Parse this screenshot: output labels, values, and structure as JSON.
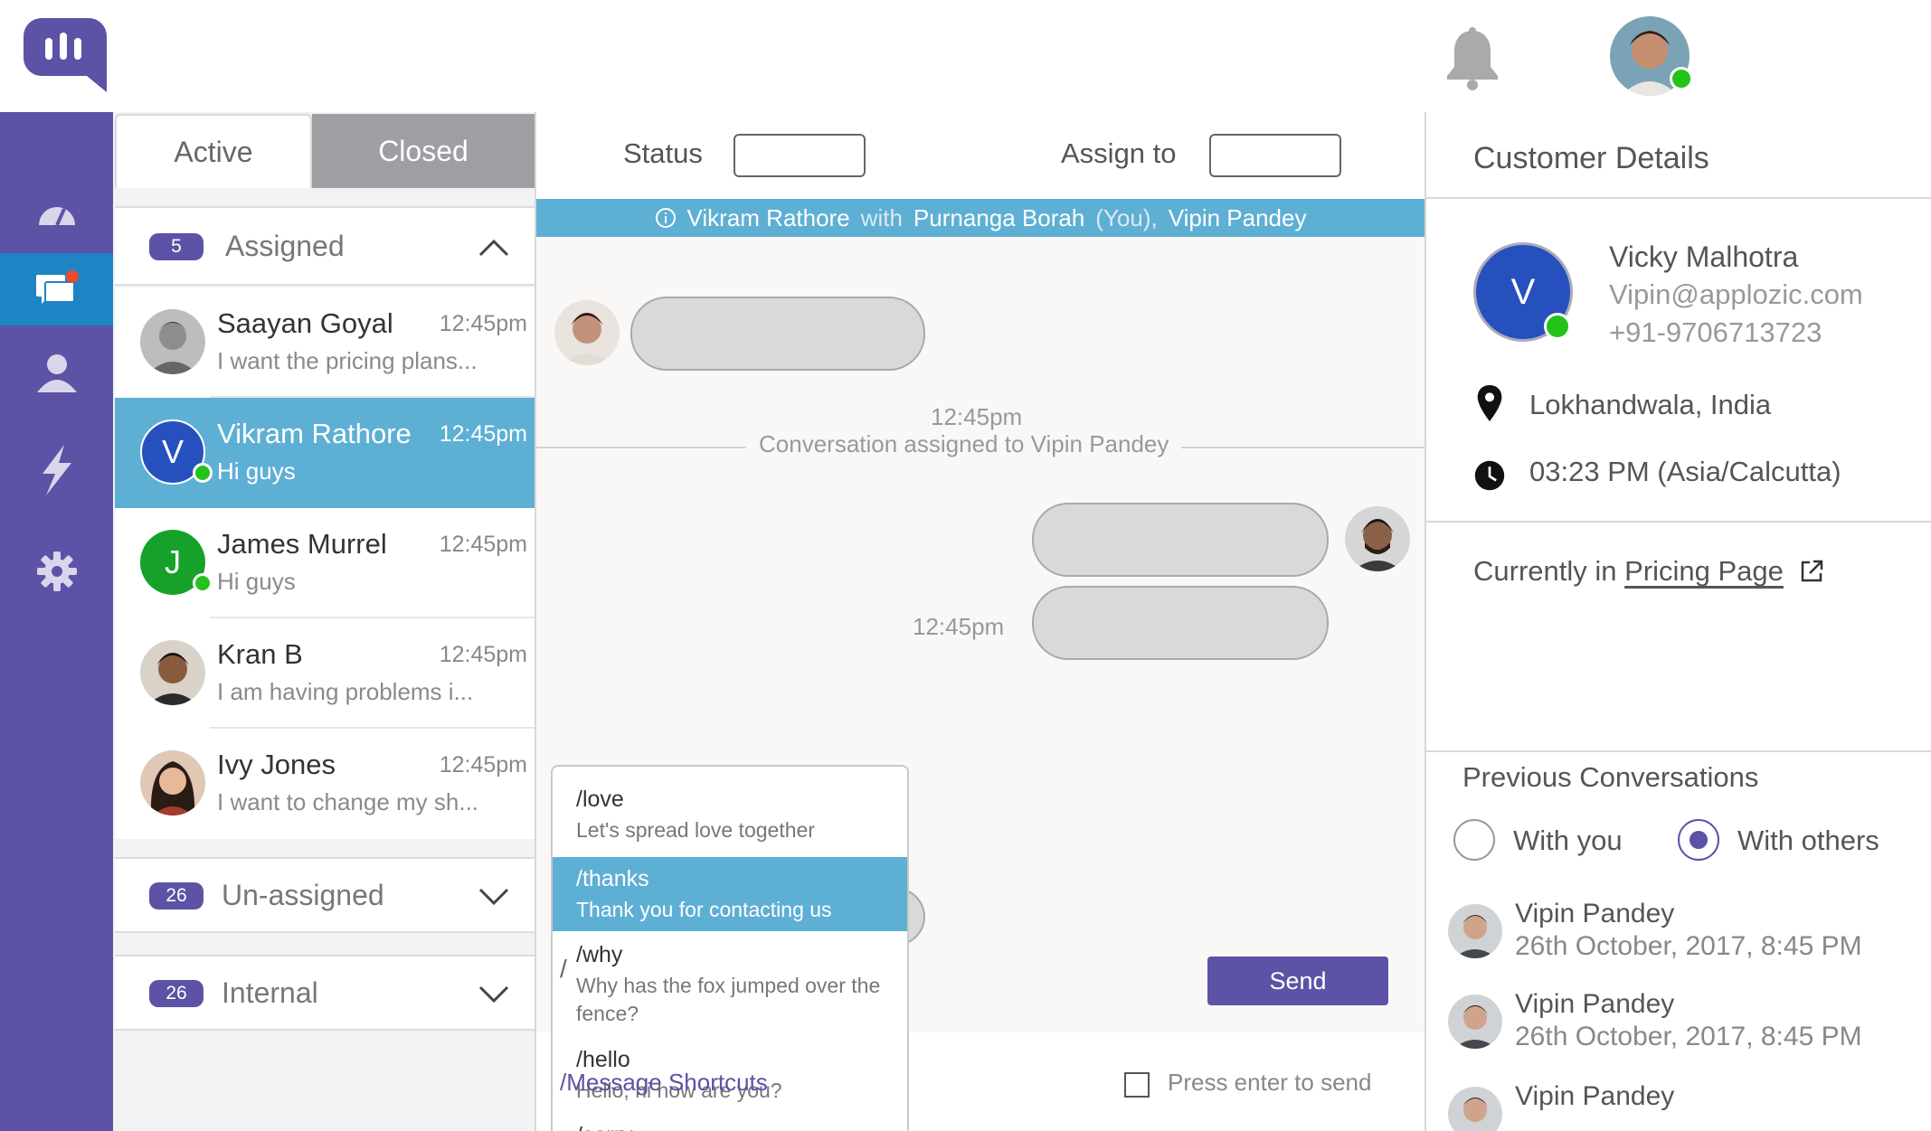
{
  "colors": {
    "brand": "#5c52a6",
    "accent_blue": "#5eafd4",
    "nav_active": "#1f84c4",
    "online": "#22c41a"
  },
  "header": {
    "logo_icon": "chat-logo-icon",
    "bell_icon": "bell-icon"
  },
  "nav": {
    "items": [
      "dashboard-icon",
      "conversations-icon",
      "users-icon",
      "integrations-icon",
      "settings-icon"
    ]
  },
  "tabs": {
    "active": "Active",
    "closed": "Closed"
  },
  "sections": {
    "assigned": {
      "count": "5",
      "label": "Assigned"
    },
    "unassigned": {
      "count": "26",
      "label": "Un-assigned"
    },
    "internal": {
      "count": "26",
      "label": "Internal"
    }
  },
  "conversations": [
    {
      "name": "Saayan Goyal",
      "time": "12:45pm",
      "msg": "I want the pricing plans..."
    },
    {
      "name": "Vikram Rathore",
      "time": "12:45pm",
      "msg": "Hi guys",
      "initial": "V"
    },
    {
      "name": "James Murrel",
      "time": "12:45pm",
      "msg": "Hi guys",
      "initial": "J"
    },
    {
      "name": "Kran B",
      "time": "12:45pm",
      "msg": "I am having problems i..."
    },
    {
      "name": "Ivy Jones",
      "time": "12:45pm",
      "msg": "I want to change my sh..."
    }
  ],
  "chat": {
    "status_label": "Status",
    "assign_label": "Assign to",
    "info": {
      "customer": "Vikram Rathore",
      "with": "with",
      "agent": "Purnanga Borah",
      "you": "(You),",
      "other": "Vipin Pandey"
    },
    "time1": "12:45pm",
    "assigned_note": "Conversation assigned to Vipin Pandey",
    "time2": "12:45pm",
    "compose_value": "/",
    "send": "Send",
    "shortcut_link": "/Message Shortcuts",
    "enter_label": "Press enter to send"
  },
  "shortcuts": [
    {
      "key": "/love",
      "desc": "Let's spread love together"
    },
    {
      "key": "/thanks",
      "desc": "Thank you for contacting us"
    },
    {
      "key": "/why",
      "desc": "Why has the fox jumped over the fence?"
    },
    {
      "key": "/hello",
      "desc": "Hello, hi how are you?"
    },
    {
      "key": "/sorry",
      "desc": ""
    }
  ],
  "details": {
    "title": "Customer Details",
    "initial": "V",
    "name": "Vicky Malhotra",
    "email": "Vipin@applozic.com",
    "phone": "+91-9706713723",
    "location": "Lokhandwala, India",
    "local_time": "03:23 PM (Asia/Calcutta)",
    "current_prefix": "Currently in",
    "current_page": "Pricing Page",
    "prev_title": "Previous Conversations",
    "radio_you": "With you",
    "radio_others": "With others",
    "previous": [
      {
        "name": "Vipin Pandey",
        "date": "26th October, 2017, 8:45 PM"
      },
      {
        "name": "Vipin Pandey",
        "date": "26th October, 2017, 8:45 PM"
      },
      {
        "name": "Vipin Pandey",
        "date": ""
      }
    ]
  }
}
